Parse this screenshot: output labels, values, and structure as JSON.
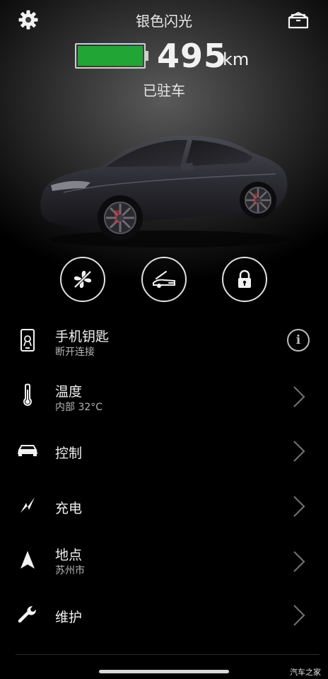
{
  "header": {
    "car_name": "银色闪光",
    "settings_icon": "gear-icon",
    "frunk_icon": "frunk-icon"
  },
  "battery": {
    "range_value": "495",
    "range_unit": "km",
    "level_percent": 100,
    "fill_color": "#21a535"
  },
  "status": "已驻车",
  "quick_controls": [
    {
      "name": "fan-icon",
      "label": ""
    },
    {
      "name": "trunk-icon",
      "label": ""
    },
    {
      "name": "lock-icon",
      "label": ""
    }
  ],
  "menu": {
    "phone_key": {
      "title": "手机钥匙",
      "subtitle": "断开连接",
      "icon": "phone-key-icon"
    },
    "climate": {
      "title": "温度",
      "subtitle": "内部 32°C",
      "icon": "thermometer-icon"
    },
    "controls": {
      "title": "控制",
      "icon": "car-icon"
    },
    "charging": {
      "title": "充电",
      "icon": "charge-bolt-icon"
    },
    "location": {
      "title": "地点",
      "subtitle": "苏州市",
      "icon": "navigation-arrow-icon"
    },
    "service": {
      "title": "维护",
      "icon": "wrench-icon"
    }
  },
  "watermark": "汽车之家"
}
